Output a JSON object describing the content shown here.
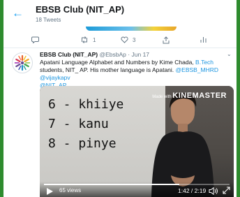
{
  "header": {
    "back_icon": "back-arrow-icon",
    "title": "EBSB Club (NIT_AP)",
    "tweet_count": "18 Tweets"
  },
  "prev_tweet_actions": {
    "reply_icon": "reply-icon",
    "retweet_count": "1",
    "like_count": "3",
    "share_icon": "share-icon",
    "analytics_icon": "analytics-icon"
  },
  "tweet": {
    "name": "EBSB Club (NIT_AP)",
    "handle": "@EbsbAp",
    "separator": "·",
    "date": "Jun 17",
    "body_text_1": "Apatani Language Alphabet and Numbers by Kime Chada, ",
    "body_link_1": "B.Tech",
    "body_text_2": " students, NIT_ AP. His mother language is Apatani. ",
    "body_link_2": "@EBSB_MHRD",
    "body_text_3": " ",
    "body_link_3": "@vijaykapv",
    "body_link_4": "@NIT_AP"
  },
  "video": {
    "slide_lines": [
      "6 - khiiye",
      "7 - kanu",
      "8 - pinye"
    ],
    "watermark_small": "Made with",
    "watermark_brand": "KINEMASTER",
    "views": "65 views",
    "time": "1:42 / 2:19",
    "progress_fraction": 0.73
  },
  "colors": {
    "accent": "#1da1f2",
    "link": "#1b95e0",
    "background_border": "#2e8b2e"
  }
}
